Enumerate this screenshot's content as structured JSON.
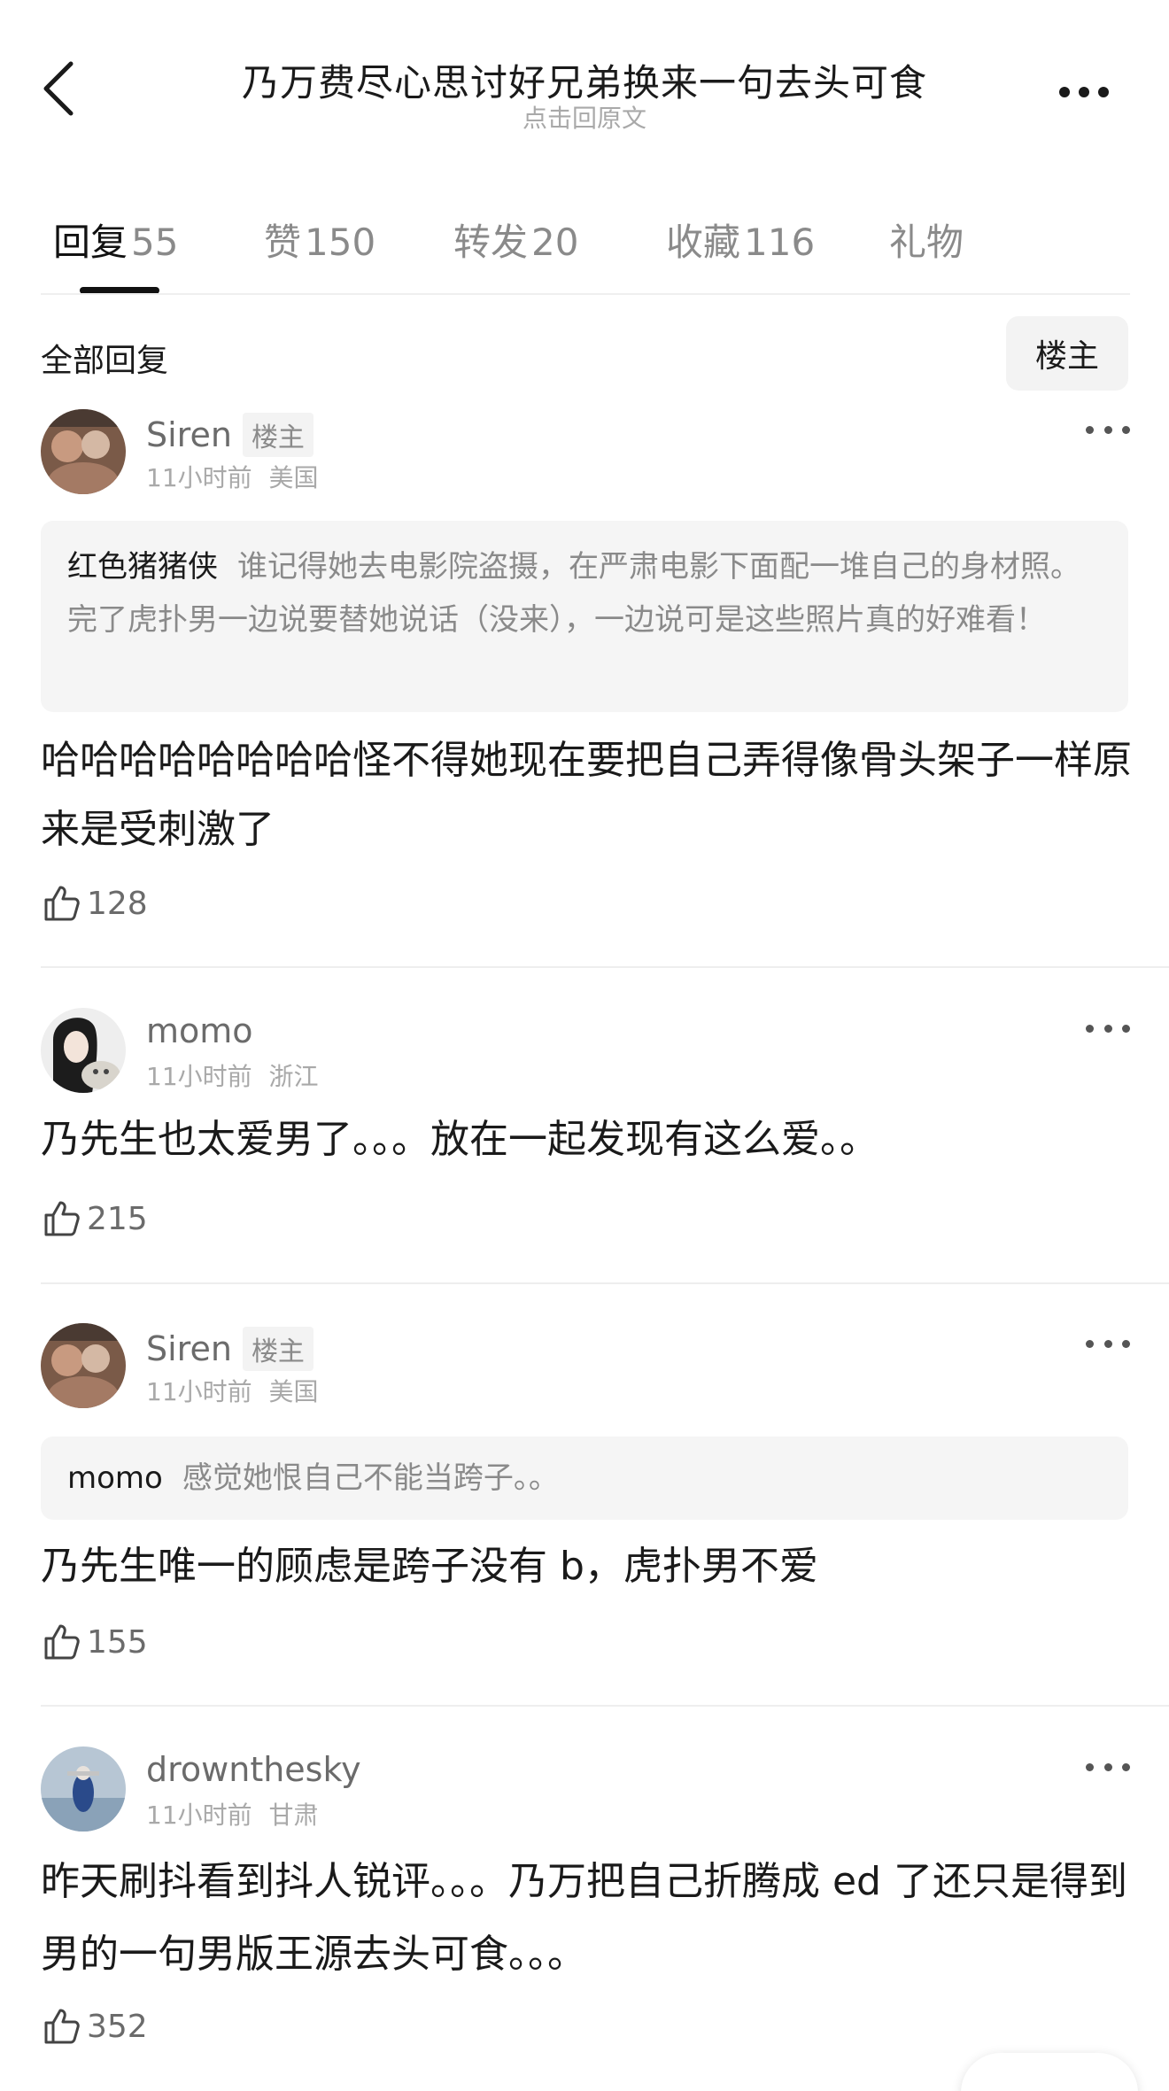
{
  "header": {
    "title": "乃万费尽心思讨好兄弟换来一句去头可食",
    "subtitle": "点击回原文",
    "back_icon": "chevron-left-icon",
    "more_icon": "more-horizontal-icon"
  },
  "tabs": [
    {
      "name": "回复",
      "count": "55",
      "active": true
    },
    {
      "name": "赞",
      "count": "150",
      "active": false
    },
    {
      "name": "转发",
      "count": "20",
      "active": false
    },
    {
      "name": "收藏",
      "count": "116",
      "active": false
    },
    {
      "name": "礼物",
      "count": "",
      "active": false
    }
  ],
  "section": {
    "title": "全部回复",
    "filter_label": "楼主"
  },
  "comments": [
    {
      "user": "Siren",
      "badge": "楼主",
      "time": "11小时前",
      "location": "美国",
      "quote_user": "红色猪猪侠",
      "quote_text": "谁记得她去电影院盗摄，在严肃电影下面配一堆自己的身材照。完了虎扑男一边说要替她说话（没来），一边说可是这些照片真的好难看！",
      "text": "哈哈哈哈哈哈哈哈怪不得她现在要把自己弄得像骨头架子一样原来是受刺激了",
      "likes": "128"
    },
    {
      "user": "momo",
      "badge": "",
      "time": "11小时前",
      "location": "浙江",
      "text": "乃先生也太爱男了。。。放在一起发现有这么爱。。",
      "likes": "215"
    },
    {
      "user": "Siren",
      "badge": "楼主",
      "time": "11小时前",
      "location": "美国",
      "quote_user": "momo",
      "quote_text": "感觉她恨自己不能当跨子。。",
      "text": "乃先生唯一的顾虑是跨子没有 b，虎扑男不爱",
      "likes": "155"
    },
    {
      "user": "drownthesky",
      "badge": "",
      "time": "11小时前",
      "location": "甘肃",
      "text": "昨天刷抖看到抖人锐评。。。乃万把自己折腾成 ed 了还只是得到男的一句男版王源去头可食。。。",
      "likes": "352"
    }
  ],
  "colors": {
    "text_primary": "#1a1a1a",
    "text_secondary": "#6b6b6b",
    "text_muted": "#a9a9a9",
    "quote_bg": "#f5f5f5"
  }
}
